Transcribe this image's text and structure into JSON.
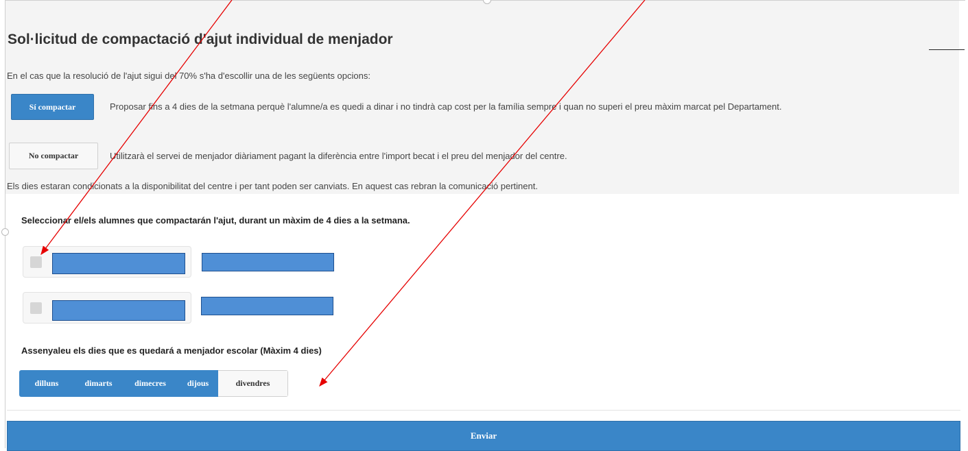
{
  "form": {
    "title": "Sol·licitud de compactació d'ajut individual de menjador",
    "intro": "En el cas que la resolució de l'ajut sigui del 70% s'ha d'escollir una de les següents opcions:",
    "option_si": {
      "label": "Sí compactar",
      "description": "Proposar fins a 4 dies de la setmana perquè l'alumne/a es quedi a dinar i no tindrà cap cost per la família sempre i quan no superi el preu màxim marcat pel Departament."
    },
    "option_no": {
      "label": "No compactar",
      "description": "Utilitzarà el servei de menjador diàriament pagant la diferència entre l'import becat i el preu del menjador del centre."
    },
    "notice": "Els dies estaran condicionats a la disponibilitat del centre i per tant poden ser canviats. En aquest cas rebran la comunicació pertinent.",
    "students_label": "Seleccionar el/els alumnes que compactarán l'ajut, durant un màxim de 4 dies a la setmana.",
    "days_label": "Assenyaleu els dies que es quedará a menjador escolar (Màxim 4 dies)",
    "days": [
      {
        "label": "dilluns",
        "selected": true
      },
      {
        "label": "dimarts",
        "selected": true
      },
      {
        "label": "dimecres",
        "selected": true
      },
      {
        "label": "dijous",
        "selected": true
      },
      {
        "label": "divendres",
        "selected": false
      }
    ],
    "submit_label": "Enviar"
  },
  "colors": {
    "primary": "#3a86c8",
    "redaction": "#4f8fd6",
    "annotation_arrow": "#e60000"
  }
}
